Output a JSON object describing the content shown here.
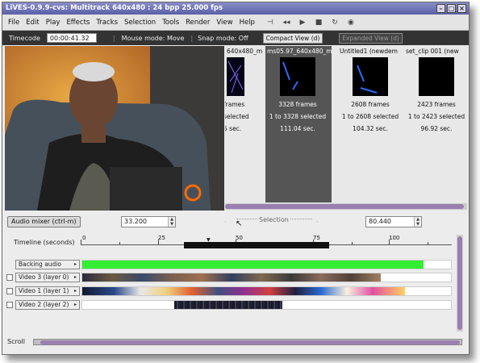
{
  "window": {
    "title": "LiVES-0.9.9-cvs: Multitrack 640x480 : 24 bpp 25.000 fps"
  },
  "menu": [
    "File",
    "Edit",
    "Play",
    "Effects",
    "Tracks",
    "Selection",
    "Tools",
    "Render",
    "View",
    "Help"
  ],
  "toolbar": {
    "timecode_label": "Timecode",
    "timecode_value": "00:00:41.32",
    "mouse_mode": "Mouse mode: Move",
    "snap_mode": "Snap mode: Off",
    "compact_view": "Compact View (d)",
    "expanded_view": "Expanded View (d)"
  },
  "clips": [
    {
      "name": "640x480_m",
      "frames": "frames",
      "selected": "selected",
      "duration": "5 sec."
    },
    {
      "name": "ms05.97_640x480_m",
      "frames": "3328 frames",
      "selected": "1 to 3328 selected",
      "duration": "111.04 sec."
    },
    {
      "name": "Untitled1 (newdem",
      "frames": "2608 frames",
      "selected": "1 to 2608 selected",
      "duration": "104.32 sec."
    },
    {
      "name": "set_clip 001 (new",
      "frames": "2423 frames",
      "selected": "1 to 2423 selected",
      "duration": "96.92 sec."
    }
  ],
  "selection": {
    "audio_mixer": "Audio mixer (ctrl-m)",
    "start": "33.200",
    "label": "Selection",
    "end": "80.440"
  },
  "timeline": {
    "label": "Timeline (seconds)",
    "ticks": [
      "0",
      "25",
      "50",
      "75",
      "100"
    ],
    "tracks": [
      "Backing audio",
      "Video 3 (layer 0)",
      "Video 1 (layer 1)",
      "Video 2 (layer 2)"
    ]
  },
  "scroll_label": "Scroll",
  "colors": {
    "audio_green": "#33ee33",
    "scroll_purple": "#9a7fb0",
    "toolbar_bg": "#333333"
  }
}
